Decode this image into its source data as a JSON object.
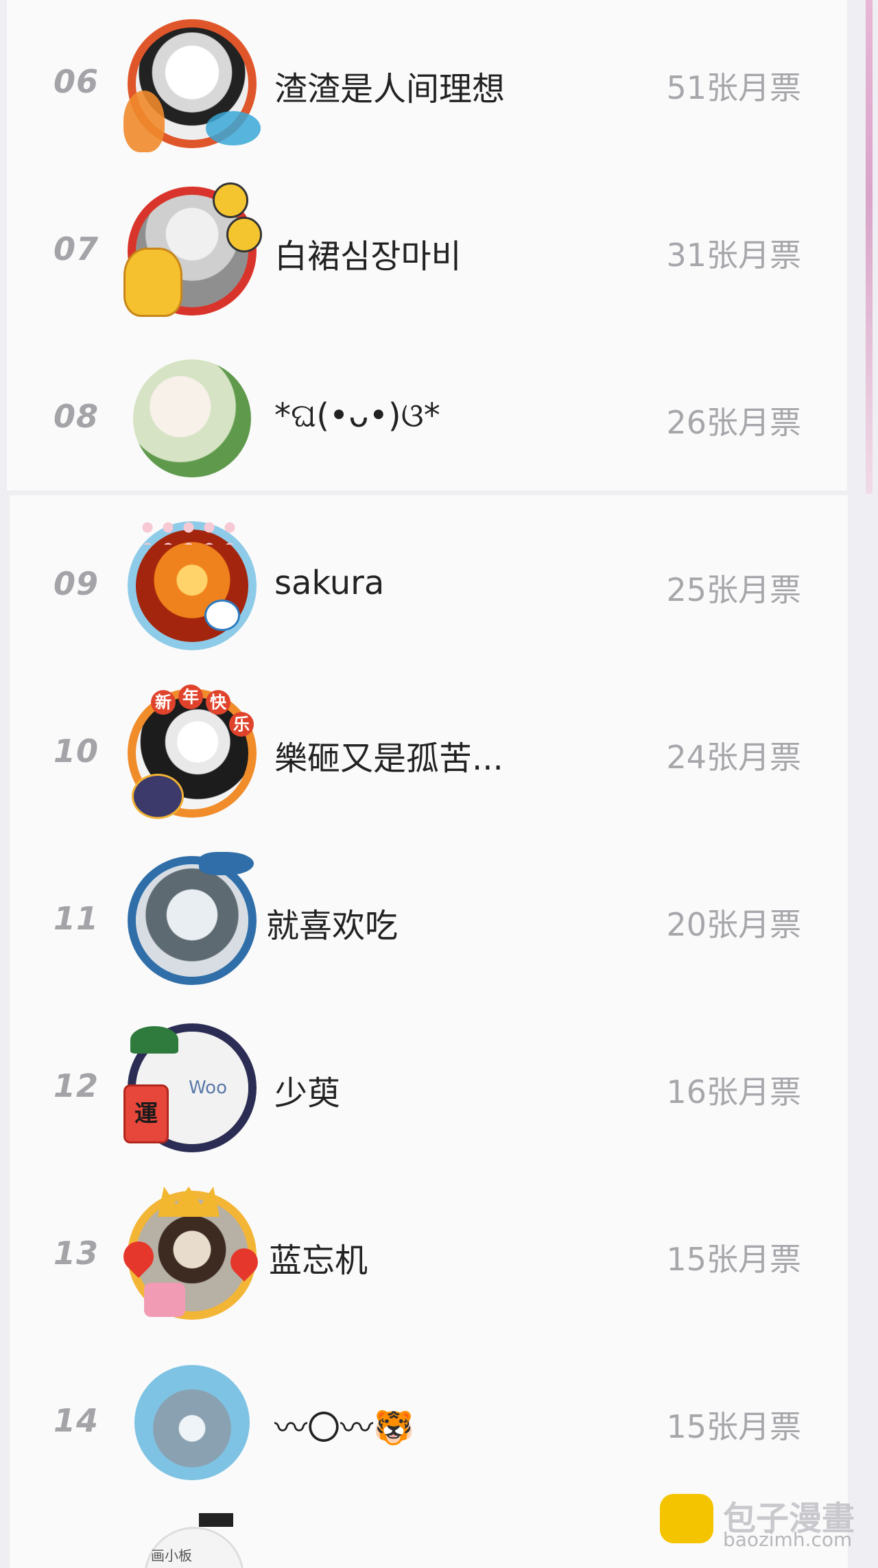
{
  "rows": [
    {
      "rank": "06",
      "name": "渣渣是人间理想",
      "votes": "51张月票"
    },
    {
      "rank": "07",
      "name": "白裙심장마비",
      "votes": "31张月票"
    },
    {
      "rank": "08",
      "name": "*ଘ(•ᴗ•)ଓ*",
      "votes": "26张月票"
    },
    {
      "rank": "09",
      "name": "sakura",
      "votes": "25张月票"
    },
    {
      "rank": "10",
      "name": "樂砸又是孤苦...",
      "votes": "24张月票"
    },
    {
      "rank": "11",
      "name": "就喜欢吃",
      "votes": "20张月票"
    },
    {
      "rank": "12",
      "name": "少萸",
      "votes": "16张月票"
    },
    {
      "rank": "13",
      "name": "蓝忘机",
      "votes": "15张月票"
    },
    {
      "rank": "14",
      "name": "〰〇〰🐯",
      "votes": "15张月票"
    }
  ],
  "avatar_badges": {
    "new_year": [
      "新",
      "年",
      "快",
      "乐"
    ],
    "luck_tag": "運",
    "avatar_12_text": "Woo",
    "avatar_15_text": "画小板"
  },
  "watermark": {
    "title": "包子漫畫",
    "url": "baozimh.com"
  },
  "colors": {
    "rank": "#a3a3a8",
    "votes": "#a6a6ab",
    "name": "#222222",
    "watermark_logo": "#f5c400"
  }
}
